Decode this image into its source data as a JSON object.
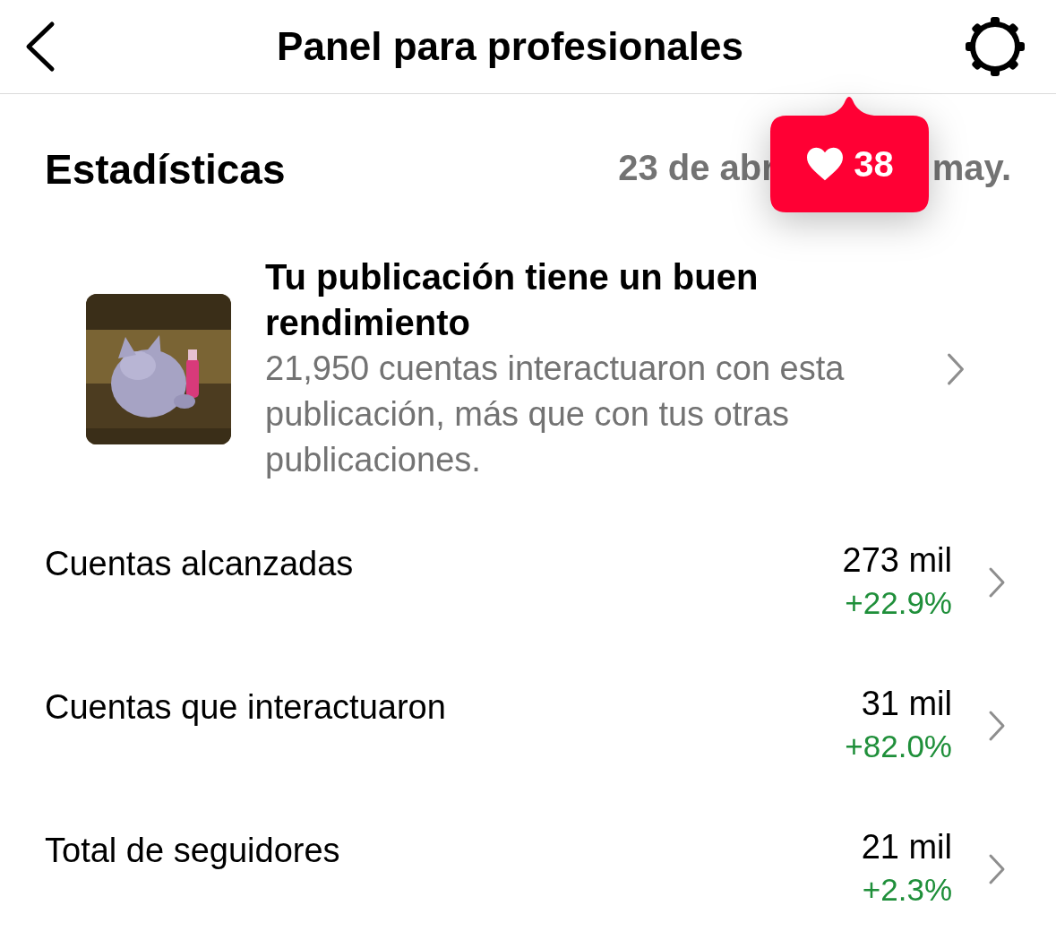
{
  "header": {
    "title": "Panel para profesionales"
  },
  "statistics": {
    "title": "Estadísticas",
    "date_start": "23 de abr",
    "date_end": "may."
  },
  "likes_tooltip": {
    "count": "38"
  },
  "highlight": {
    "title": "Tu publicación tiene un buen rendimiento",
    "description": "21,950 cuentas interactuaron con esta publicación, más que con tus otras publicaciones."
  },
  "metrics": [
    {
      "label": "Cuentas alcanzadas",
      "value": "273 mil",
      "change": "+22.9%"
    },
    {
      "label": "Cuentas que interactuaron",
      "value": "31 mil",
      "change": "+82.0%"
    },
    {
      "label": "Total de seguidores",
      "value": "21 mil",
      "change": "+2.3%"
    }
  ]
}
